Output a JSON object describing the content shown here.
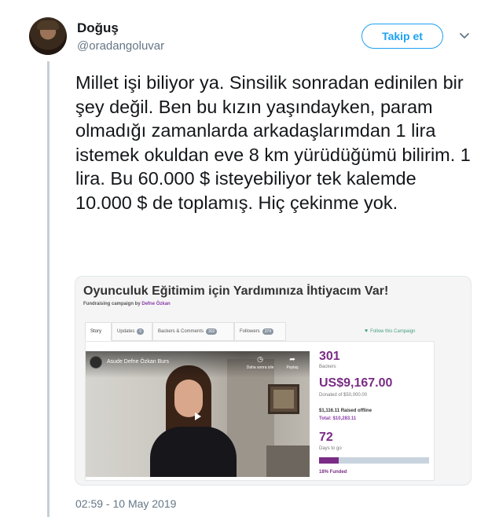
{
  "user": {
    "display_name": "Doğuş",
    "handle": "@oradangoluvar",
    "follow_label": "Takip et"
  },
  "tweet": {
    "text": "Millet işi biliyor ya. Sinsilik sonradan edinilen bir şey değil. Ben bu kızın yaşındayken, param olmadığı zamanlarda arkadaşlarımdan 1 lira istemek okuldan eve 8 km yürüdüğümü bilirim. 1 lira. Bu 60.000 $ isteyebiliyor tek kalemde 10.000 $ de toplamış. Hiç çekinme yok.",
    "timestamp": "02:59 - 10 May 2019"
  },
  "card": {
    "title": "Oyunculuk Eğitimim için Yardımınıza İhtiyacım Var!",
    "subtitle_prefix": "Fundraising campaign by",
    "author": "Defne Özkan",
    "tabs": [
      {
        "label": "Story",
        "badge": ""
      },
      {
        "label": "Updates",
        "badge": "0"
      },
      {
        "label": "Backers & Comments",
        "badge": "302"
      },
      {
        "label": "Followers",
        "badge": "374"
      }
    ],
    "follow_campaign": "Follow this Campaign",
    "video": {
      "title": "Asude Defne Özkan Burs",
      "watch_later": "Daha sonra izle",
      "share": "Paylaş"
    },
    "stats": {
      "backers_count": "301",
      "backers_label": "Backers",
      "raised": "US$9,167.00",
      "donated_of": "Donated of $50,000.00",
      "offline": "$1,116.11 Raised offline",
      "total": "Total: $10,283.11",
      "days_count": "72",
      "days_label": "Days to go",
      "funded_fraction": 0.18,
      "funded_label": "18% Funded"
    }
  },
  "colors": {
    "accent": "#1da1f2",
    "campaign_purple": "#7a2c86",
    "campaign_green": "#43a082"
  },
  "icons": [
    "avatar",
    "chevron-down-icon",
    "heart-icon",
    "clock-icon",
    "share-icon",
    "play-icon"
  ]
}
